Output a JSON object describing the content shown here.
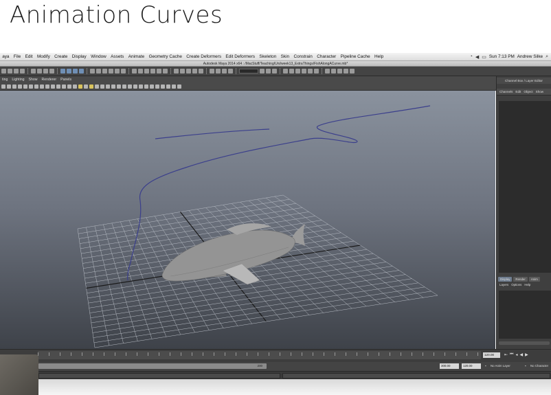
{
  "slide": {
    "title": "Animation Curves"
  },
  "menubar": {
    "items": [
      "aya",
      "File",
      "Edit",
      "Modify",
      "Create",
      "Display",
      "Window",
      "Assets",
      "Animate",
      "Geometry Cache",
      "Create Deformers",
      "Edit Deformers",
      "Skeleton",
      "Skin",
      "Constrain",
      "Character",
      "Pipeline Cache",
      "Help"
    ],
    "clock": "Sun 7:13 PM",
    "user": "Andrew Silke"
  },
  "window": {
    "title": "Autodesk Maya 2014 x64 : /MacStuff/Teaching/Uni/week13_ExtraThings/FishAlongACurve.mb*"
  },
  "panel_menu": {
    "items": [
      "ting",
      "Lighting",
      "Show",
      "Renderer",
      "Panels"
    ]
  },
  "channel_box": {
    "title": "Channel Box / Layer Editor",
    "tabs": [
      "Channels",
      "Edit",
      "Object",
      "Show"
    ]
  },
  "layer_editor": {
    "tabs": [
      "Display",
      "Render",
      "Anim"
    ],
    "menu": [
      "Layers",
      "Options",
      "Help"
    ]
  },
  "time_slider": {
    "current_frame": "120.00"
  },
  "range_slider": {
    "bar_label": "200",
    "end_field": "300.00",
    "start_field": "120.00",
    "anim_layer": "No Anim Layer",
    "character": "No Character"
  },
  "colors": {
    "curve": "#3b3f8c",
    "grid": "#b9bec6",
    "grid_axis": "#1a1a1a",
    "fish_body": "#8f8f8f",
    "viewport_top": "#8a929e",
    "viewport_bottom": "#3e4249"
  }
}
